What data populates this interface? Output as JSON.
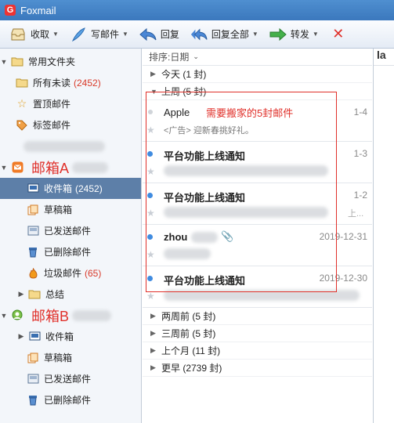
{
  "app": {
    "title": "Foxmail"
  },
  "toolbar": {
    "receive": "收取",
    "compose": "写邮件",
    "reply": "回复",
    "reply_all": "回复全部",
    "forward": "转发"
  },
  "sidebar": {
    "common_folder": "常用文件夹",
    "all_unread": "所有未读",
    "all_unread_count": "(2452)",
    "pinned": "置顶邮件",
    "tagged": "标签邮件",
    "account_a": {
      "label": "邮箱A",
      "inbox": "收件箱",
      "inbox_count": "(2452)",
      "drafts": "草稿箱",
      "sent": "已发送邮件",
      "deleted": "已删除邮件",
      "junk": "垃圾邮件",
      "junk_count": "(65)",
      "summary": "总结"
    },
    "account_b": {
      "label": "邮箱B",
      "inbox": "收件箱",
      "drafts": "草稿箱",
      "sent": "已发送邮件",
      "deleted": "已删除邮件"
    }
  },
  "list": {
    "sort": "排序:日期",
    "groups": {
      "today": "今天 (1 封)",
      "last_week": "上周 (5 封)",
      "two_weeks": "两周前 (5 封)",
      "three_weeks": "三周前 (5 封)",
      "last_month": "上个月 (11 封)",
      "earlier": "更早 (2739 封)"
    },
    "mails": [
      {
        "from": "Apple",
        "date": "1-4",
        "subject": "<广告> 迎新春挑好礼。"
      },
      {
        "from": "平台功能上线通知",
        "date": "1-3",
        "subject": ""
      },
      {
        "from": "平台功能上线通知",
        "date": "1-2",
        "subject": "上..."
      },
      {
        "from": "zhou",
        "date": "2019-12-31",
        "subject": ""
      },
      {
        "from": "平台功能上线通知",
        "date": "2019-12-30",
        "subject": ""
      }
    ]
  },
  "preview": {
    "title": "la"
  },
  "annotation": {
    "note": "需要搬家的5封邮件"
  },
  "colors": {
    "accent": "#5d7fa8",
    "annotation": "#e0302a",
    "unread_dot": "#3f8be0"
  }
}
